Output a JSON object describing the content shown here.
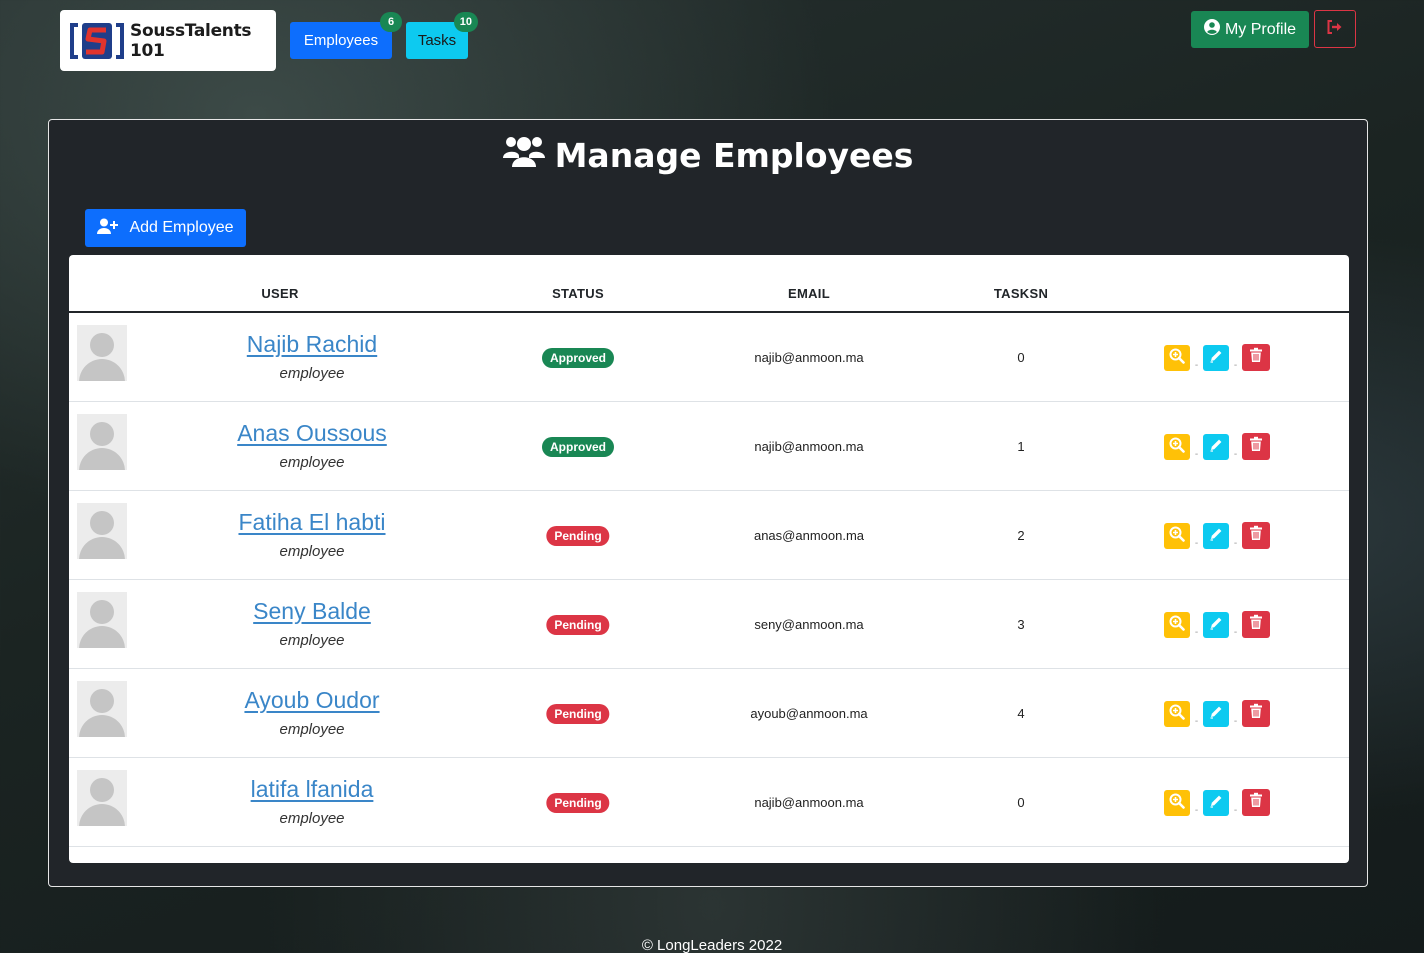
{
  "brand": {
    "name": "SoussTalents 101"
  },
  "nav": {
    "employees": {
      "label": "Employees",
      "count": "6"
    },
    "tasks": {
      "label": "Tasks",
      "count": "10"
    },
    "profile_label": "My Profile"
  },
  "page": {
    "title": "Manage Employees",
    "add_label": "Add Employee"
  },
  "table": {
    "columns": [
      "USER",
      "STATUS",
      "EMAIL",
      "TASKSN"
    ],
    "rows": [
      {
        "name": "Najib Rachid",
        "role": "employee",
        "status": "Approved",
        "email": "najib@anmoon.ma",
        "tasks": "0"
      },
      {
        "name": "Anas Oussous",
        "role": "employee",
        "status": "Approved",
        "email": "najib@anmoon.ma",
        "tasks": "1"
      },
      {
        "name": "Fatiha El habti",
        "role": "employee",
        "status": "Pending",
        "email": "anas@anmoon.ma",
        "tasks": "2"
      },
      {
        "name": "Seny Balde",
        "role": "employee",
        "status": "Pending",
        "email": "seny@anmoon.ma",
        "tasks": "3"
      },
      {
        "name": "Ayoub Oudor",
        "role": "employee",
        "status": "Pending",
        "email": "ayoub@anmoon.ma",
        "tasks": "4"
      },
      {
        "name": "latifa lfanida",
        "role": "employee",
        "status": "Pending",
        "email": "najib@anmoon.ma",
        "tasks": "0"
      }
    ],
    "action_separator": "-"
  },
  "footer": {
    "text": "© LongLeaders 2022"
  },
  "colors": {
    "primary": "#0d6efd",
    "info": "#0dcaf0",
    "success": "#198754",
    "danger": "#dc3545",
    "warning": "#ffc107",
    "panel": "#212529"
  }
}
